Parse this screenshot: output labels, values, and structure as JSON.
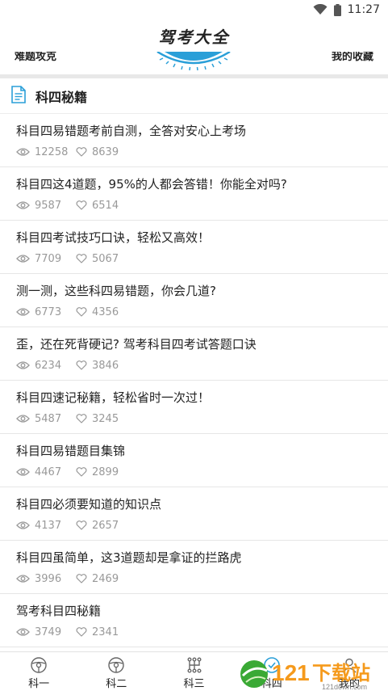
{
  "status": {
    "time": "11:27",
    "wifi_icon": "wifi-icon",
    "battery_icon": "battery-icon"
  },
  "header": {
    "title": "驾考大全"
  },
  "shortcuts": {
    "left_label": "难题攻克",
    "right_label": "我的收藏"
  },
  "section": {
    "title": "科四秘籍",
    "icon": "document-icon"
  },
  "articles": [
    {
      "title": "科目四易错题考前自测，全答对安心上考场",
      "views": "12258",
      "likes": "8639"
    },
    {
      "title": "科目四这4道题，95%的人都会答错！你能全对吗?",
      "views": "9587",
      "likes": "6514"
    },
    {
      "title": "科目四考试技巧口诀，轻松又高效！",
      "views": "7709",
      "likes": "5067"
    },
    {
      "title": "测一测，这些科四易错题，你会几道?",
      "views": "6773",
      "likes": "4356"
    },
    {
      "title": "歪，还在死背硬记? 驾考科目四考试答题口诀",
      "views": "6234",
      "likes": "3846"
    },
    {
      "title": "科目四速记秘籍，轻松省时一次过！",
      "views": "5487",
      "likes": "3245"
    },
    {
      "title": "科目四易错题目集锦",
      "views": "4467",
      "likes": "2899"
    },
    {
      "title": "科目四必须要知道的知识点",
      "views": "4137",
      "likes": "2657"
    },
    {
      "title": "科目四虽简单，这3道题却是拿证的拦路虎",
      "views": "3996",
      "likes": "2469"
    },
    {
      "title": "驾考科目四秘籍",
      "views": "3749",
      "likes": "2341"
    }
  ],
  "tabs": [
    {
      "label": "科一",
      "icon": "steering-wheel-icon"
    },
    {
      "label": "科二",
      "icon": "steering-wheel-icon"
    },
    {
      "label": "科三",
      "icon": "gear-shift-icon"
    },
    {
      "label": "科四",
      "icon": "subject-four-icon"
    },
    {
      "label": "我的",
      "icon": "profile-icon"
    }
  ],
  "watermark": {
    "number": "121",
    "text": "下载站",
    "sub": "121down.com"
  },
  "colors": {
    "accent": "#2a9fd8",
    "watermark": "#f59a1c",
    "watermark_green": "#3aa935",
    "meta_gray": "#999999"
  }
}
